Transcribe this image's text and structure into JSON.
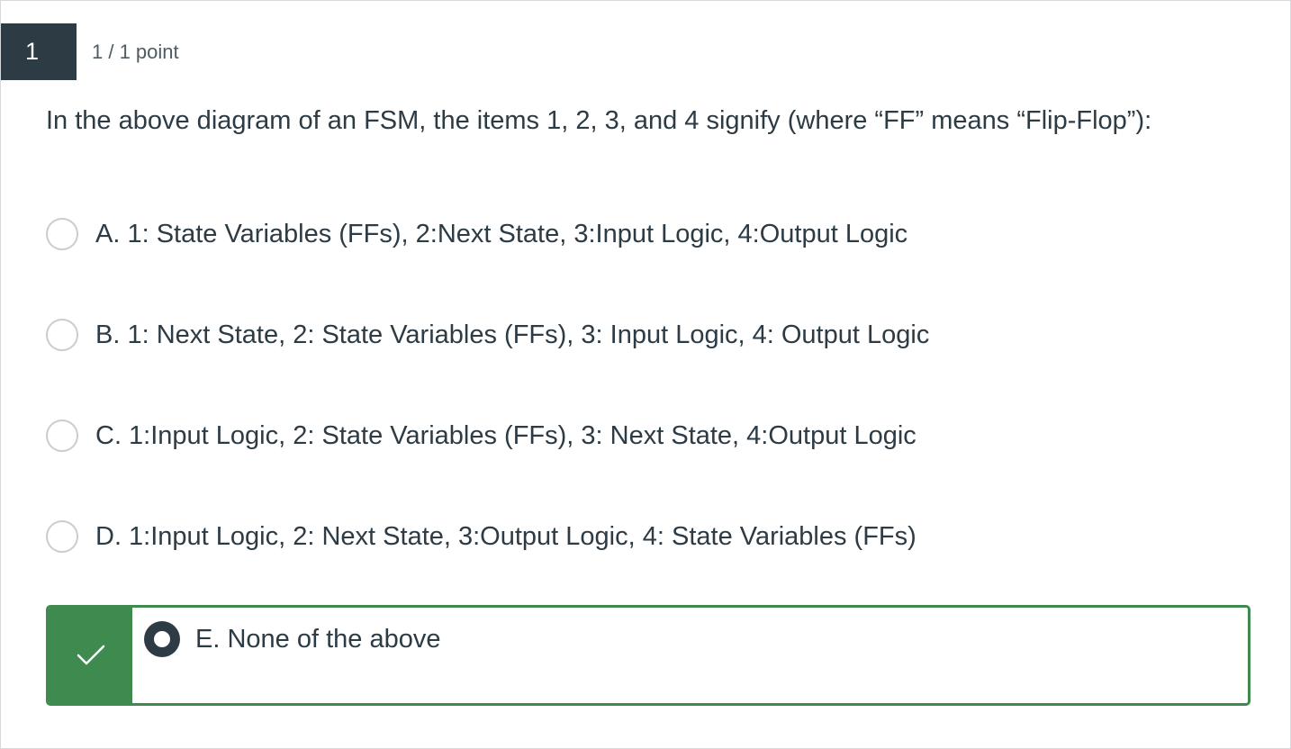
{
  "question": {
    "number": "1",
    "points": "1 / 1 point",
    "text": "In the above diagram of an FSM, the items 1, 2, 3, and 4 signify (where “FF” means “Flip-Flop”):"
  },
  "answers": [
    {
      "label": "A. 1: State Variables (FFs), 2:Next State, 3:Input Logic, 4:Output Logic",
      "selected": false
    },
    {
      "label": "B. 1: Next State, 2: State Variables (FFs), 3: Input Logic, 4: Output Logic",
      "selected": false
    },
    {
      "label": "C. 1:Input Logic, 2: State Variables (FFs), 3: Next State, 4:Output Logic",
      "selected": false
    },
    {
      "label": "D. 1:Input Logic, 2: Next State, 3:Output Logic, 4: State Variables (FFs)",
      "selected": false
    },
    {
      "label": "E. None of the above",
      "selected": true,
      "correct": true
    }
  ],
  "colors": {
    "header_bg": "#2d3b45",
    "correct_green": "#3f8a4f",
    "text": "#2d3b45",
    "radio_border": "#c7cdd1"
  },
  "icons": {
    "correct_indicator": "check-icon"
  }
}
